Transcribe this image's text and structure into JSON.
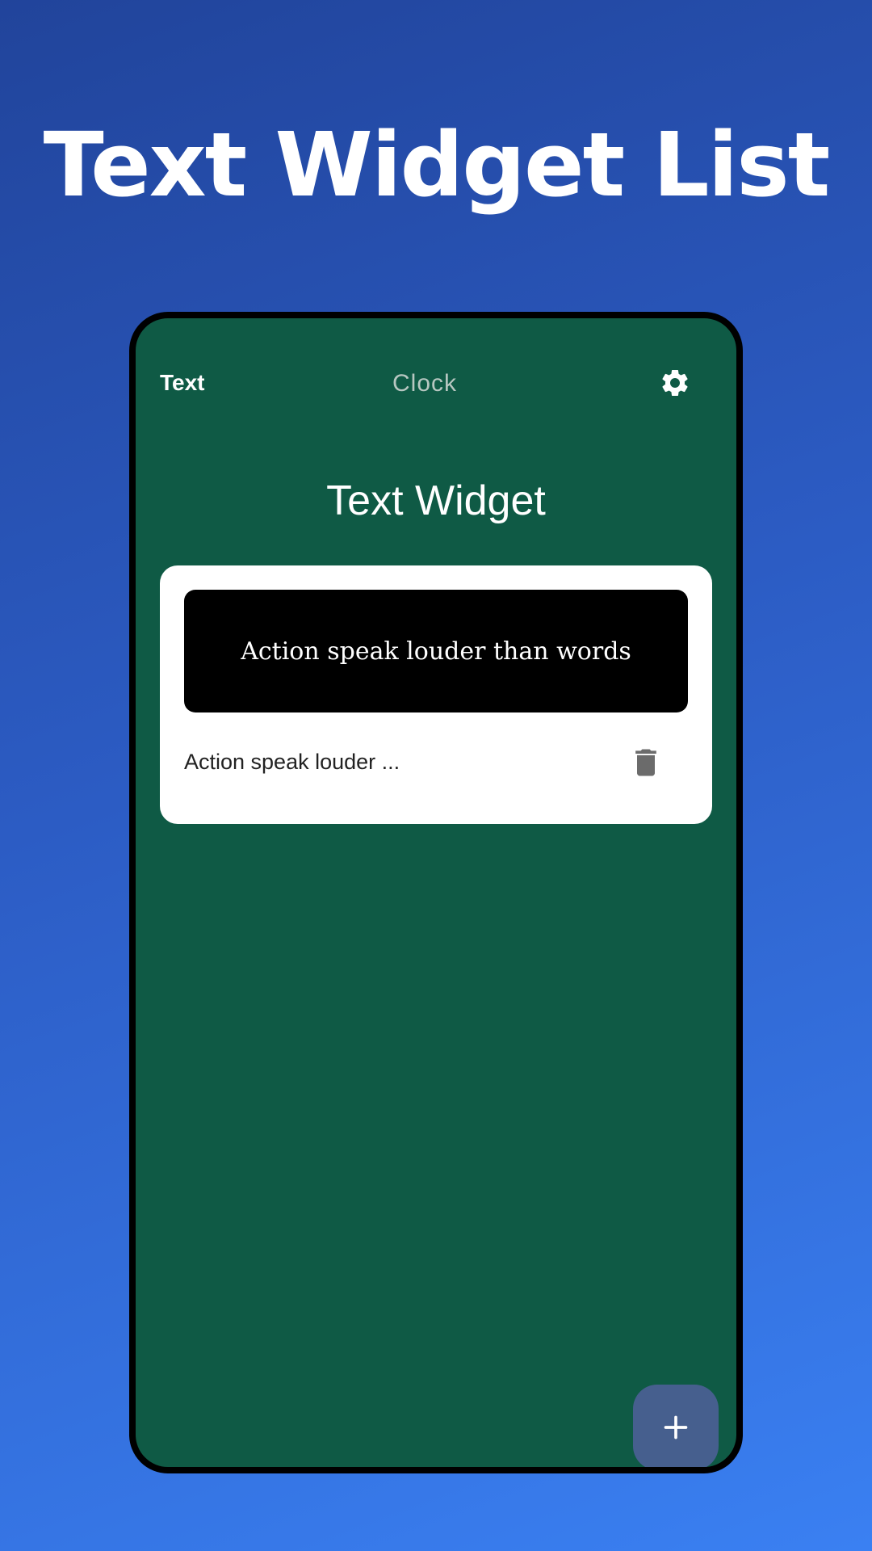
{
  "promo": {
    "title": "Text Widget List"
  },
  "tabs": [
    {
      "label": "Text",
      "active": true
    },
    {
      "label": "Clock",
      "active": false
    }
  ],
  "icons": {
    "settings": "gear-icon",
    "delete": "trash-icon",
    "add": "plus-icon"
  },
  "screen": {
    "heading": "Text Widget"
  },
  "widgets": [
    {
      "preview_text": "Action speak louder than words",
      "label": "Action speak louder ..."
    }
  ],
  "colors": {
    "background_gradient": [
      "#21449b",
      "#3a80f2"
    ],
    "app_background": "#0f5a45",
    "card": "#ffffff",
    "preview_background": "#000000",
    "fab": "#465f8e",
    "inactive_tab": "#b7c7c1"
  }
}
